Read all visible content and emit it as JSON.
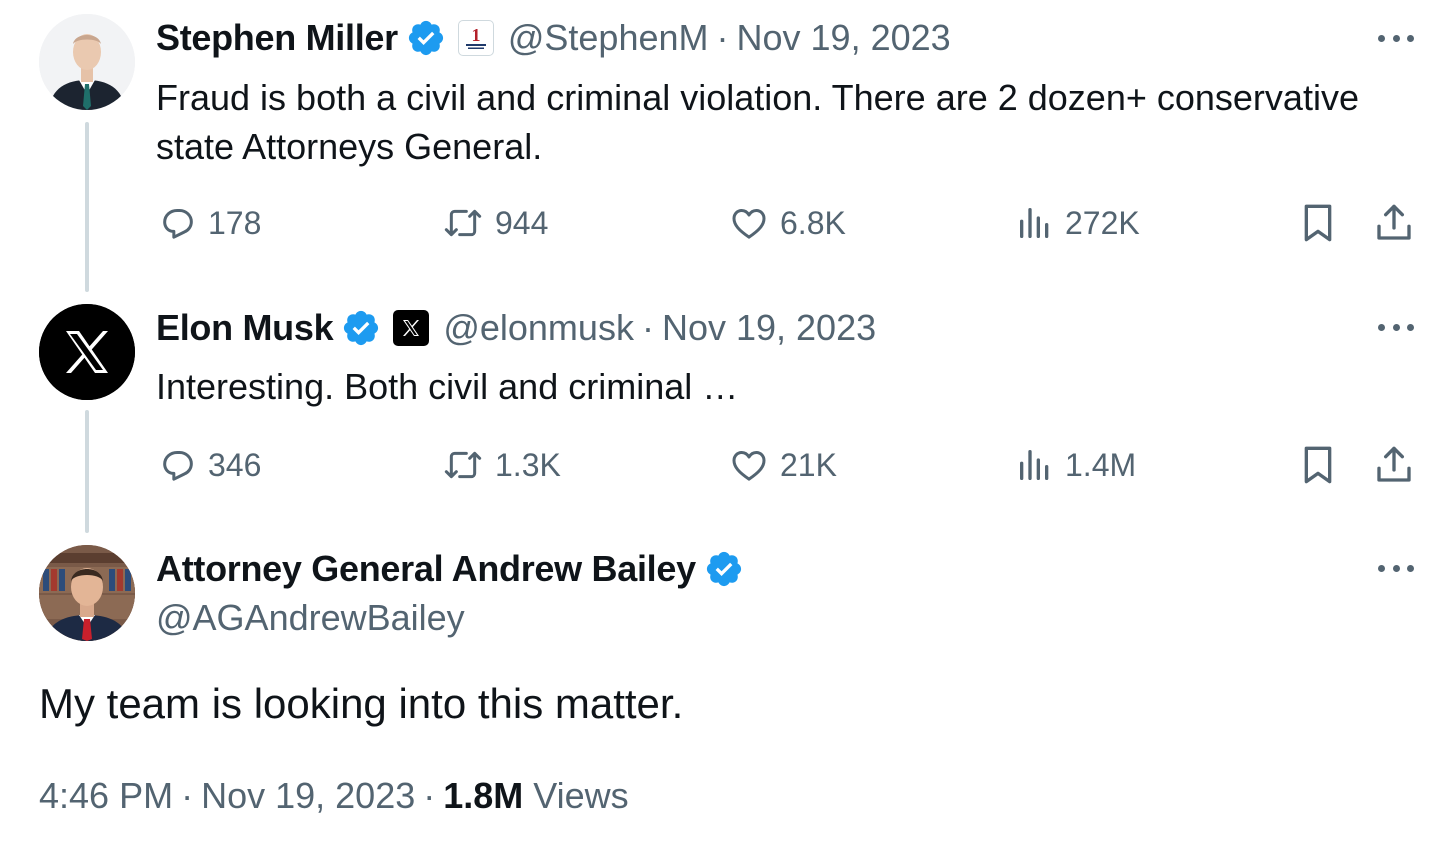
{
  "thread": [
    {
      "avatar": "person-avatar",
      "display_name": "Stephen Miller",
      "verified": true,
      "affiliation_badge": "america-first-legal-badge",
      "handle": "@StephenM",
      "separator": "·",
      "date": "Nov 19, 2023",
      "text_lines": [
        "Fraud is both a civil and criminal violation. There are 2 dozen+ conservative",
        "state Attorneys General."
      ],
      "stats": {
        "replies": "178",
        "reposts": "944",
        "likes": "6.8K",
        "views": "272K"
      }
    },
    {
      "avatar": "x-logo-avatar",
      "display_name": "Elon Musk",
      "verified": true,
      "affiliation_badge": "x-badge",
      "handle": "@elonmusk",
      "separator": "·",
      "date": "Nov 19, 2023",
      "text_lines": [
        "Interesting. Both civil and criminal …"
      ],
      "stats": {
        "replies": "346",
        "reposts": "1.3K",
        "likes": "21K",
        "views": "1.4M"
      }
    }
  ],
  "main_tweet": {
    "avatar": "person-avatar",
    "display_name": "Attorney General Andrew Bailey",
    "verified": true,
    "handle": "@AGAndrewBailey",
    "text": "My team is looking into this matter.",
    "time": "4:46 PM",
    "separator": "·",
    "date": "Nov 19, 2023",
    "views_count": "1.8M",
    "views_label": "Views"
  },
  "colors": {
    "text_primary": "#0f1419",
    "text_secondary": "#536471",
    "verified_blue": "#1d9bf0",
    "thread_line": "#cfd9de"
  }
}
